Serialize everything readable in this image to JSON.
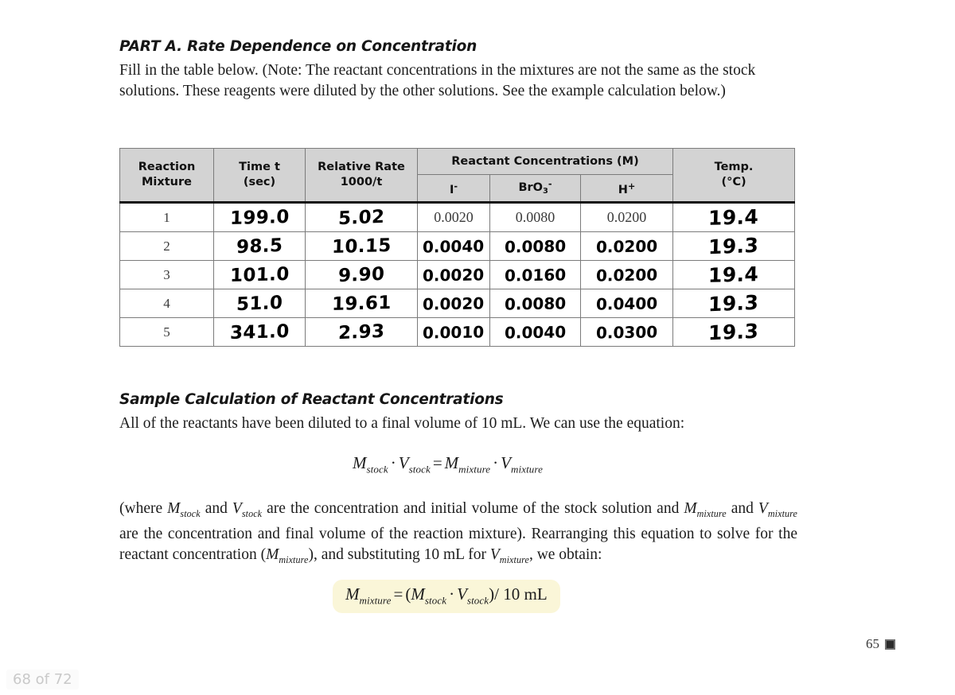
{
  "document": {
    "part_heading": "PART A. Rate Dependence on Concentration",
    "intro_paragraph": "Fill in the table below. (Note: The reactant concentrations in the mixtures are not the same as the stock solutions. These reagents were diluted by the other solutions. See the example calculation below.)",
    "sample_heading": "Sample Calculation of Reactant Concentrations",
    "sample_paragraph": "All of the reactants have been diluted to a final volume of 10 mL. We can use the equation:",
    "equation_main": {
      "left_m": "M",
      "left_m_sub": "stock",
      "left_v": "V",
      "left_v_sub": "stock",
      "operator_dot": "·",
      "equals": "=",
      "right_m": "M",
      "right_m_sub": "mixture",
      "right_v": "V",
      "right_v_sub": "mixture"
    },
    "where_paragraph": {
      "p1": "(where ",
      "m1": "M",
      "m1sub": "stock",
      "p2": " and ",
      "v1": "V",
      "v1sub": "stock",
      "p3": " are the concentration and initial volume of the stock solution and ",
      "m2": "M",
      "m2sub": "mixture",
      "p4": " and ",
      "v2": "V",
      "v2sub": "mixture",
      "p5": " are the concentration and final volume of the reaction mixture). Rearranging this equation to solve for the reactant concentration (",
      "m3": "M",
      "m3sub": "mixture",
      "p6": "), and substituting 10 mL for ",
      "v3": "V",
      "v3sub": "mixture",
      "p7": ", we obtain:"
    },
    "equation_highlighted": {
      "m_mix": "M",
      "m_mix_sub": "mixture",
      "equals": "=",
      "open": "(",
      "m_stock": "M",
      "m_stock_sub": "stock",
      "dot": "·",
      "v_stock": "V",
      "v_stock_sub": "stock",
      "close": ")",
      "divisor": "/ 10 mL"
    },
    "page_number": "65",
    "highlight_color": "#faf6d8"
  },
  "table": {
    "headers": {
      "reaction_mixture": "Reaction\nMixture",
      "reaction_mixture_l1": "Reaction",
      "reaction_mixture_l2": "Mixture",
      "time_t_l1": "Time t",
      "time_t_l2": "(sec)",
      "relative_rate_l1": "Relative Rate",
      "relative_rate_l2": "1000/t",
      "reactant_concentrations": "Reactant Concentrations (M)",
      "temp_l1": "Temp.",
      "temp_l2": "(°C)",
      "sub_iodide": "I",
      "sub_iodide_sup": "-",
      "sub_bromate": "BrO",
      "sub_bromate_num": "3",
      "sub_bromate_sup": "-",
      "sub_hydrogen": "H",
      "sub_hydrogen_sup": "+"
    },
    "rows": [
      {
        "mixture": "1",
        "time": "199.0",
        "rate": "5.02",
        "iodide": "0.0020",
        "bromate": "0.0080",
        "hydrogen": "0.0200",
        "temp": "19.4",
        "prefilled": true
      },
      {
        "mixture": "2",
        "time": "98.5",
        "rate": "10.15",
        "iodide": "0.0040",
        "bromate": "0.0080",
        "hydrogen": "0.0200",
        "temp": "19.3",
        "prefilled": false
      },
      {
        "mixture": "3",
        "time": "101.0",
        "rate": "9.90",
        "iodide": "0.0020",
        "bromate": "0.0160",
        "hydrogen": "0.0200",
        "temp": "19.4",
        "prefilled": false
      },
      {
        "mixture": "4",
        "time": "51.0",
        "rate": "19.61",
        "iodide": "0.0020",
        "bromate": "0.0080",
        "hydrogen": "0.0400",
        "temp": "19.3",
        "prefilled": false
      },
      {
        "mixture": "5",
        "time": "341.0",
        "rate": "2.93",
        "iodide": "0.0010",
        "bromate": "0.0040",
        "hydrogen": "0.0300",
        "temp": "19.3",
        "prefilled": false
      }
    ]
  },
  "viewer": {
    "page_indicator": "68 of 72"
  }
}
